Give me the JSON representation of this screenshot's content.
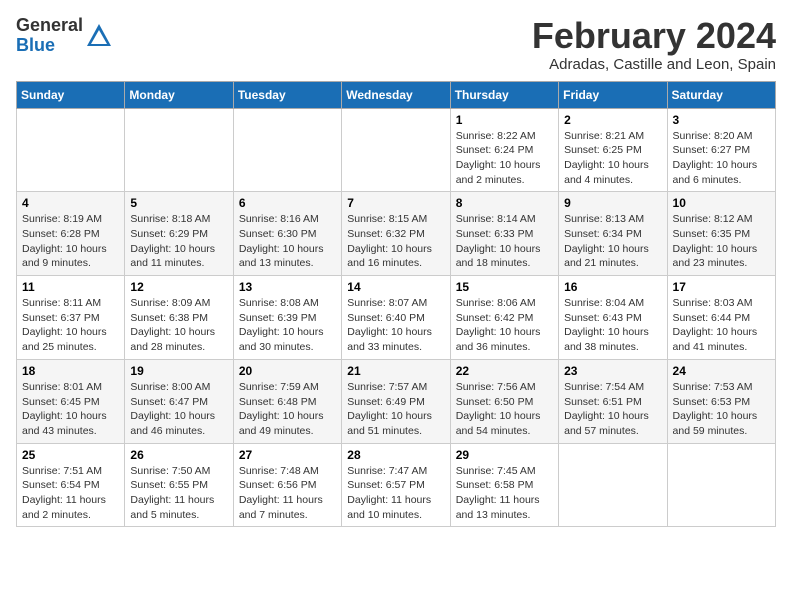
{
  "logo": {
    "general": "General",
    "blue": "Blue"
  },
  "header": {
    "month": "February 2024",
    "location": "Adradas, Castille and Leon, Spain"
  },
  "weekdays": [
    "Sunday",
    "Monday",
    "Tuesday",
    "Wednesday",
    "Thursday",
    "Friday",
    "Saturday"
  ],
  "weeks": [
    [
      {
        "day": "",
        "info": ""
      },
      {
        "day": "",
        "info": ""
      },
      {
        "day": "",
        "info": ""
      },
      {
        "day": "",
        "info": ""
      },
      {
        "day": "1",
        "info": "Sunrise: 8:22 AM\nSunset: 6:24 PM\nDaylight: 10 hours\nand 2 minutes."
      },
      {
        "day": "2",
        "info": "Sunrise: 8:21 AM\nSunset: 6:25 PM\nDaylight: 10 hours\nand 4 minutes."
      },
      {
        "day": "3",
        "info": "Sunrise: 8:20 AM\nSunset: 6:27 PM\nDaylight: 10 hours\nand 6 minutes."
      }
    ],
    [
      {
        "day": "4",
        "info": "Sunrise: 8:19 AM\nSunset: 6:28 PM\nDaylight: 10 hours\nand 9 minutes."
      },
      {
        "day": "5",
        "info": "Sunrise: 8:18 AM\nSunset: 6:29 PM\nDaylight: 10 hours\nand 11 minutes."
      },
      {
        "day": "6",
        "info": "Sunrise: 8:16 AM\nSunset: 6:30 PM\nDaylight: 10 hours\nand 13 minutes."
      },
      {
        "day": "7",
        "info": "Sunrise: 8:15 AM\nSunset: 6:32 PM\nDaylight: 10 hours\nand 16 minutes."
      },
      {
        "day": "8",
        "info": "Sunrise: 8:14 AM\nSunset: 6:33 PM\nDaylight: 10 hours\nand 18 minutes."
      },
      {
        "day": "9",
        "info": "Sunrise: 8:13 AM\nSunset: 6:34 PM\nDaylight: 10 hours\nand 21 minutes."
      },
      {
        "day": "10",
        "info": "Sunrise: 8:12 AM\nSunset: 6:35 PM\nDaylight: 10 hours\nand 23 minutes."
      }
    ],
    [
      {
        "day": "11",
        "info": "Sunrise: 8:11 AM\nSunset: 6:37 PM\nDaylight: 10 hours\nand 25 minutes."
      },
      {
        "day": "12",
        "info": "Sunrise: 8:09 AM\nSunset: 6:38 PM\nDaylight: 10 hours\nand 28 minutes."
      },
      {
        "day": "13",
        "info": "Sunrise: 8:08 AM\nSunset: 6:39 PM\nDaylight: 10 hours\nand 30 minutes."
      },
      {
        "day": "14",
        "info": "Sunrise: 8:07 AM\nSunset: 6:40 PM\nDaylight: 10 hours\nand 33 minutes."
      },
      {
        "day": "15",
        "info": "Sunrise: 8:06 AM\nSunset: 6:42 PM\nDaylight: 10 hours\nand 36 minutes."
      },
      {
        "day": "16",
        "info": "Sunrise: 8:04 AM\nSunset: 6:43 PM\nDaylight: 10 hours\nand 38 minutes."
      },
      {
        "day": "17",
        "info": "Sunrise: 8:03 AM\nSunset: 6:44 PM\nDaylight: 10 hours\nand 41 minutes."
      }
    ],
    [
      {
        "day": "18",
        "info": "Sunrise: 8:01 AM\nSunset: 6:45 PM\nDaylight: 10 hours\nand 43 minutes."
      },
      {
        "day": "19",
        "info": "Sunrise: 8:00 AM\nSunset: 6:47 PM\nDaylight: 10 hours\nand 46 minutes."
      },
      {
        "day": "20",
        "info": "Sunrise: 7:59 AM\nSunset: 6:48 PM\nDaylight: 10 hours\nand 49 minutes."
      },
      {
        "day": "21",
        "info": "Sunrise: 7:57 AM\nSunset: 6:49 PM\nDaylight: 10 hours\nand 51 minutes."
      },
      {
        "day": "22",
        "info": "Sunrise: 7:56 AM\nSunset: 6:50 PM\nDaylight: 10 hours\nand 54 minutes."
      },
      {
        "day": "23",
        "info": "Sunrise: 7:54 AM\nSunset: 6:51 PM\nDaylight: 10 hours\nand 57 minutes."
      },
      {
        "day": "24",
        "info": "Sunrise: 7:53 AM\nSunset: 6:53 PM\nDaylight: 10 hours\nand 59 minutes."
      }
    ],
    [
      {
        "day": "25",
        "info": "Sunrise: 7:51 AM\nSunset: 6:54 PM\nDaylight: 11 hours\nand 2 minutes."
      },
      {
        "day": "26",
        "info": "Sunrise: 7:50 AM\nSunset: 6:55 PM\nDaylight: 11 hours\nand 5 minutes."
      },
      {
        "day": "27",
        "info": "Sunrise: 7:48 AM\nSunset: 6:56 PM\nDaylight: 11 hours\nand 7 minutes."
      },
      {
        "day": "28",
        "info": "Sunrise: 7:47 AM\nSunset: 6:57 PM\nDaylight: 11 hours\nand 10 minutes."
      },
      {
        "day": "29",
        "info": "Sunrise: 7:45 AM\nSunset: 6:58 PM\nDaylight: 11 hours\nand 13 minutes."
      },
      {
        "day": "",
        "info": ""
      },
      {
        "day": "",
        "info": ""
      }
    ]
  ]
}
